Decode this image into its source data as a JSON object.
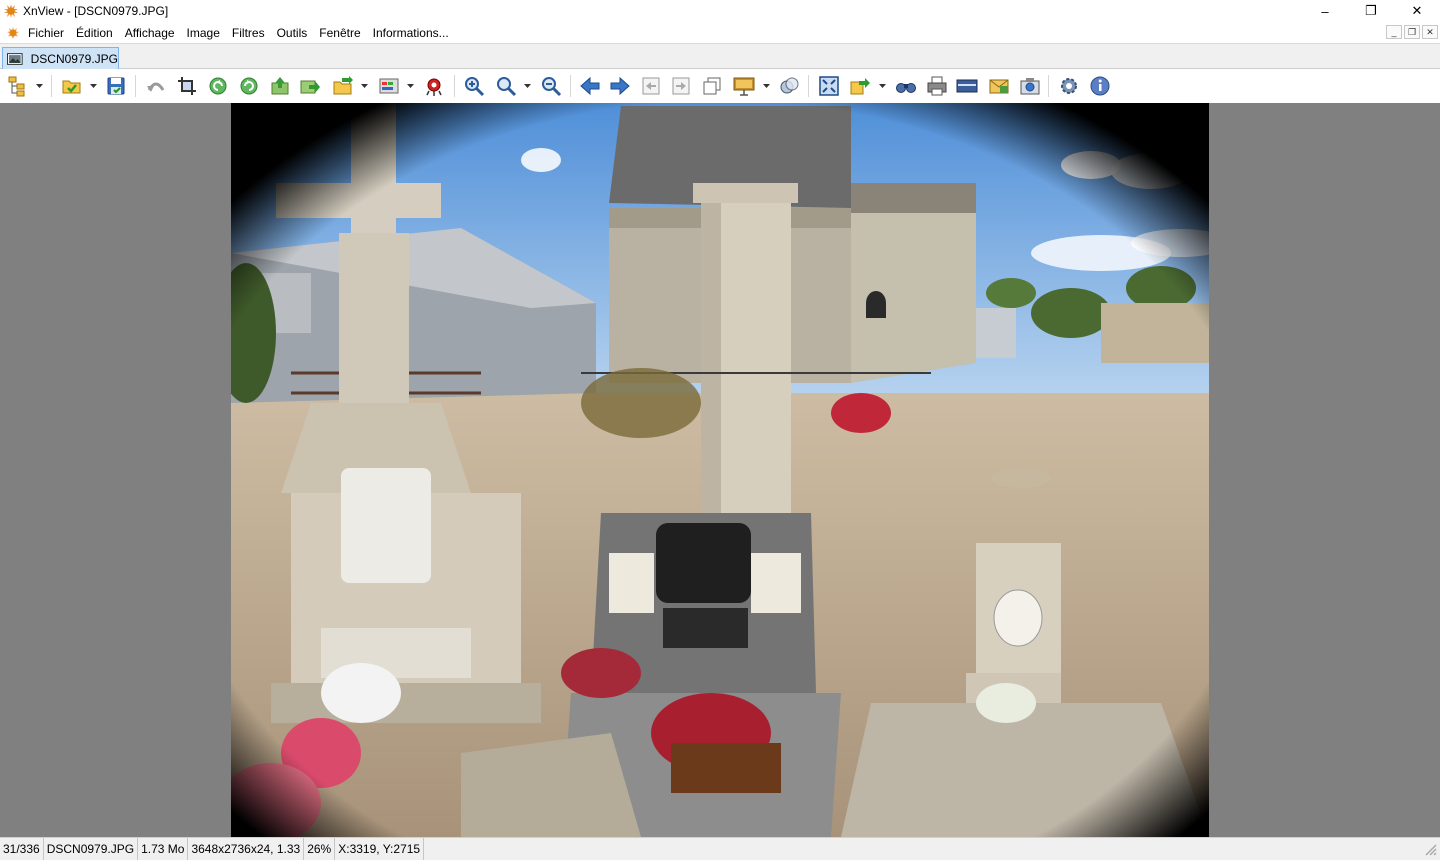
{
  "window": {
    "title": "XnView - [DSCN0979.JPG]",
    "minimize": "–",
    "maximize": "❐",
    "close": "✕"
  },
  "menu": {
    "items": [
      {
        "label": "Fichier"
      },
      {
        "label": "Édition"
      },
      {
        "label": "Affichage"
      },
      {
        "label": "Image"
      },
      {
        "label": "Filtres"
      },
      {
        "label": "Outils"
      },
      {
        "label": "Fenêtre"
      },
      {
        "label": "Informations..."
      }
    ],
    "mdi": {
      "minimize": "_",
      "restore": "❐",
      "close": "✕"
    }
  },
  "tab": {
    "label": "DSCN0979.JPG"
  },
  "toolbar": {
    "buttons": [
      {
        "icon": "browser-tree-icon"
      },
      {
        "icon": "open-folder-icon"
      },
      {
        "icon": "save-icon"
      },
      {
        "icon": "undo-icon"
      },
      {
        "icon": "crop-icon"
      },
      {
        "icon": "rotate-left-icon"
      },
      {
        "icon": "rotate-right-icon"
      },
      {
        "icon": "acquire-icon"
      },
      {
        "icon": "export-icon"
      },
      {
        "icon": "folder-arrow-icon"
      },
      {
        "icon": "adjust-icon"
      },
      {
        "icon": "red-eye-icon"
      },
      {
        "icon": "zoom-in-icon"
      },
      {
        "icon": "zoom-icon"
      },
      {
        "icon": "zoom-out-icon"
      },
      {
        "icon": "previous-icon"
      },
      {
        "icon": "next-icon"
      },
      {
        "icon": "first-page-icon"
      },
      {
        "icon": "last-page-icon"
      },
      {
        "icon": "copy-icon"
      },
      {
        "icon": "slideshow-icon"
      },
      {
        "icon": "compare-icon"
      },
      {
        "icon": "fullscreen-icon"
      },
      {
        "icon": "batch-icon"
      },
      {
        "icon": "find-icon"
      },
      {
        "icon": "print-icon"
      },
      {
        "icon": "scanner-icon"
      },
      {
        "icon": "email-icon"
      },
      {
        "icon": "capture-icon"
      },
      {
        "icon": "settings-icon"
      },
      {
        "icon": "info-icon"
      }
    ]
  },
  "image": {
    "filename": "DSCN0979.JPG"
  },
  "status": {
    "position": "31/336",
    "filename": "DSCN0979.JPG",
    "filesize": "1.73 Mo",
    "dimensions": "3648x2736x24, 1.33",
    "zoom": "26%",
    "cursor": "X:3319, Y:2715"
  },
  "colors": {
    "viewer_bg": "#808080",
    "tab_active": "#cfe3f7",
    "statusbar": "#f0f0f0"
  }
}
